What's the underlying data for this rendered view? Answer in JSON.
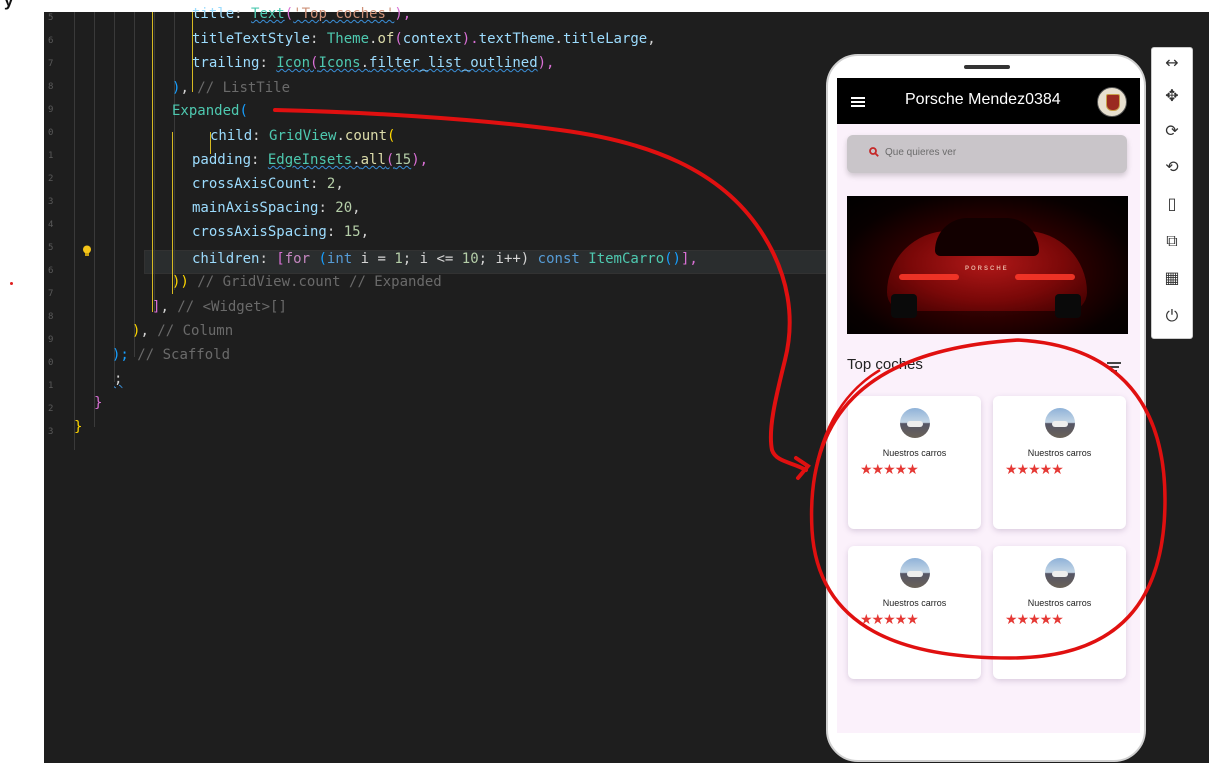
{
  "header_fragment": "y",
  "gutter": {
    "line_numbers": [
      "5",
      "6",
      "7",
      "8",
      "9",
      "0",
      "1",
      "2",
      "3",
      "4",
      "5",
      "6",
      "7",
      "8",
      "9",
      "0",
      "1",
      "2",
      "3"
    ]
  },
  "code": {
    "l1": {
      "indent": "        ",
      "a": "title",
      "b": ": ",
      "c": "Text",
      "d": "(",
      "e": "'Top coches'",
      "f": "),"
    },
    "l2": {
      "a": "titleTextStyle",
      "b": ": ",
      "c": "Theme",
      "d": ".",
      "e": "of",
      "f": "(",
      "g": "context",
      "h": ").",
      "i": "textTheme",
      "j": ".",
      "k": "titleLarge",
      "l": ","
    },
    "l3": {
      "a": "trailing",
      "b": ": ",
      "c": "Icon",
      "d": "(",
      "e": "Icons",
      "f": ".",
      "g": "filter_list_outlined",
      "h": "),"
    },
    "l4": {
      "a": ")",
      "b": ", ",
      "c": "// ListTile"
    },
    "l5": {
      "a": "Expanded",
      "b": "("
    },
    "l6": {
      "a": "child",
      "b": ": ",
      "c": "GridView",
      "d": ".",
      "e": "count",
      "f": "("
    },
    "l7": {
      "a": "padding",
      "b": ": ",
      "c": "EdgeInsets",
      "d": ".",
      "e": "all",
      "f": "(",
      "g": "15",
      "h": "),"
    },
    "l8": {
      "a": "crossAxisCount",
      "b": ": ",
      "c": "2",
      "d": ","
    },
    "l9": {
      "a": "mainAxisSpacing",
      "b": ": ",
      "c": "20",
      "d": ","
    },
    "l10": {
      "a": "crossAxisSpacing",
      "b": ": ",
      "c": "15",
      "d": ","
    },
    "l11": {
      "a": "children",
      "b": ": ",
      "c": "[",
      "d": "for",
      "e": " (",
      "f": "int",
      "g": " i = ",
      "h": "1",
      "i": "; i <= ",
      "j": "10",
      "k": "; i++) ",
      "l": "const",
      "m": " ",
      "n": "ItemCarro",
      "o": "()",
      "p": "],"
    },
    "l12": {
      "a": "))",
      "b": " ",
      "c": "// GridView.count // Expanded"
    },
    "l13": {
      "a": "]",
      "b": ", ",
      "c": "// <Widget>[]"
    },
    "l14": {
      "a": ")",
      "b": ", ",
      "c": "// Column"
    },
    "l15": {
      "a": ");",
      "b": " ",
      "c": "// Scaffold"
    },
    "l16": {
      "a": ";"
    },
    "l17": {
      "a": "}"
    },
    "l18": {
      "a": "}"
    }
  },
  "phone": {
    "app_title": "Porsche Mendez0384",
    "search_placeholder": "Que quieres ver",
    "section_title": "Top coches",
    "hero_badge": "PORSCHE",
    "cards": [
      {
        "title": "Nuestros carros",
        "stars": "★★★★★"
      },
      {
        "title": "Nuestros carros",
        "stars": "★★★★★"
      },
      {
        "title": "Nuestros carros",
        "stars": "★★★★★"
      },
      {
        "title": "Nuestros carros",
        "stars": "★★★★★"
      }
    ]
  },
  "toolbar": {
    "resize": "↔",
    "move": "✥",
    "rotate": "⟳",
    "rotate_screen": "⟲",
    "device": "▯",
    "external": "⧉",
    "qr": "▦",
    "power": "⏻"
  },
  "colors": {
    "editor_bg": "#1e1e1e",
    "annotation": "#e01010",
    "stars": "#e53935",
    "appbar": "#000000"
  }
}
